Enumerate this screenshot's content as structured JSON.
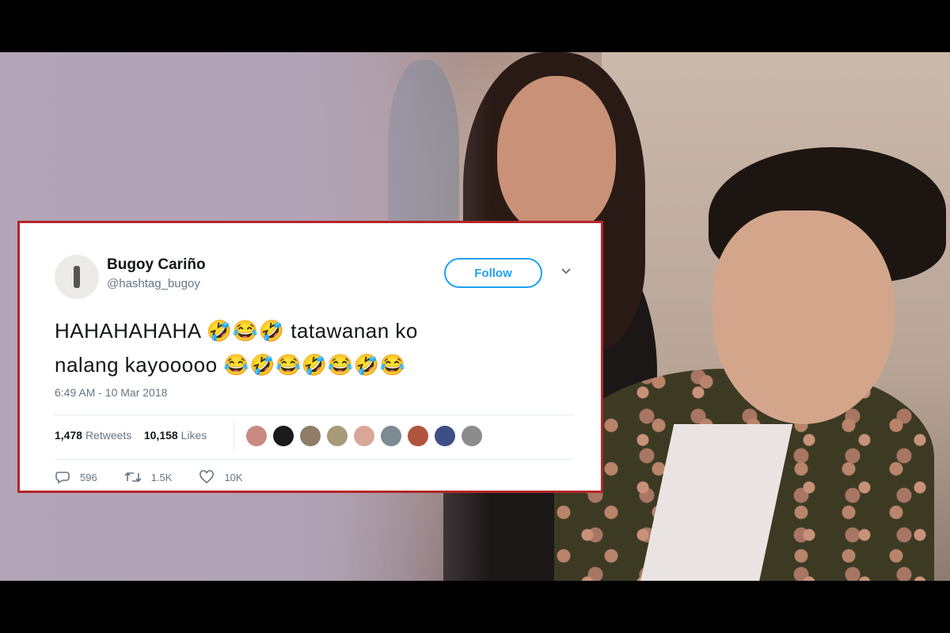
{
  "tweet": {
    "author_name": "Bugoy Cariño",
    "author_handle": "@hashtag_bugoy",
    "follow_label": "Follow",
    "text_line1": "HAHAHAHAHA 🤣😂🤣 tatawanan ko",
    "text_line2": "nalang kayooooo 😂🤣😂🤣😂🤣😂",
    "timestamp": "6:49 AM - 10 Mar 2018",
    "retweets_count": "1,478",
    "retweets_label": "Retweets",
    "likes_count": "10,158",
    "likes_label": "Likes",
    "reply_count": "596",
    "retweet_action_count": "1.5K",
    "like_action_count": "10K"
  },
  "icons": {
    "avatar": "profile-avatar",
    "menu": "chevron-down-icon",
    "reply": "reply-icon",
    "retweet": "retweet-icon",
    "like": "heart-icon"
  },
  "colors": {
    "card_border": "#b3262a",
    "follow_accent": "#1da1f2",
    "muted_text": "#657786"
  }
}
